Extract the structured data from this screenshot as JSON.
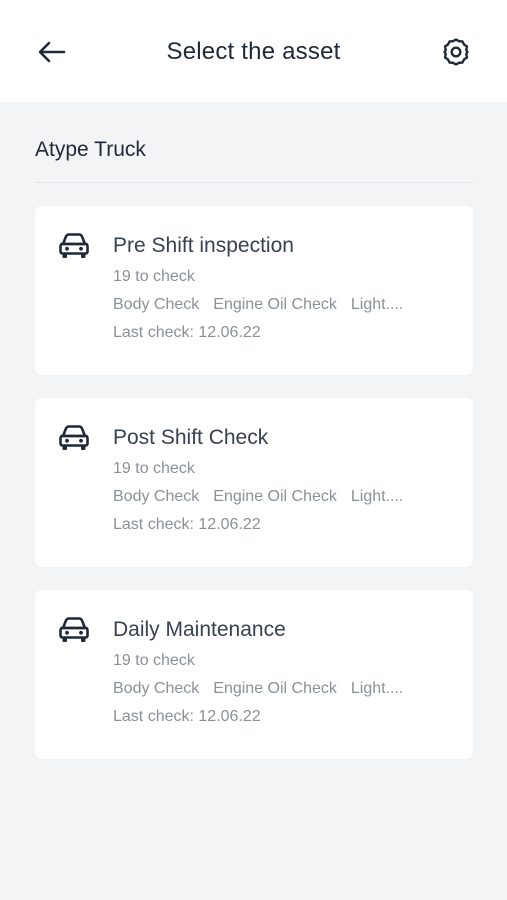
{
  "header": {
    "title": "Select the asset",
    "back_icon": "arrow-left-icon",
    "settings_icon": "gear-icon"
  },
  "section": {
    "title": "Atype Truck"
  },
  "cards": [
    {
      "title": "Pre Shift inspection",
      "count": "19 to check",
      "tags": [
        "Body Check",
        "Engine Oil Check",
        "Light...."
      ],
      "last_check": "Last check: 12.06.22",
      "icon": "car-icon"
    },
    {
      "title": "Post Shift Check",
      "count": "19 to check",
      "tags": [
        "Body Check",
        "Engine Oil Check",
        "Light...."
      ],
      "last_check": "Last check: 12.06.22",
      "icon": "car-icon"
    },
    {
      "title": "Daily Maintenance",
      "count": "19 to check",
      "tags": [
        "Body Check",
        "Engine Oil Check",
        "Light...."
      ],
      "last_check": "Last check: 12.06.22",
      "icon": "car-icon"
    }
  ],
  "colors": {
    "background": "#f3f4f6",
    "surface": "#ffffff",
    "text_primary": "#1f2937",
    "text_secondary": "#8b9099"
  }
}
